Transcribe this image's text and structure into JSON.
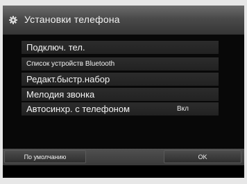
{
  "header": {
    "title": "Установки телефона",
    "icon": "gear-icon"
  },
  "menu": {
    "items": [
      {
        "label": "Подключ. тел.",
        "value": ""
      },
      {
        "label": "Список устройств Bluetooth",
        "value": ""
      },
      {
        "label": "Редакт.быстр.набор",
        "value": ""
      },
      {
        "label": "Мелодия звонка",
        "value": ""
      },
      {
        "label": "Автосинхр. с телефоном",
        "value": "Вкл"
      }
    ]
  },
  "footer": {
    "default_label": "По умолчанию",
    "ok_label": "OK"
  },
  "colors": {
    "screen_background": "#000000",
    "frame_background": "#e7e7e7",
    "text": "#f4f4f4",
    "row_background": "#2a2a2a"
  }
}
